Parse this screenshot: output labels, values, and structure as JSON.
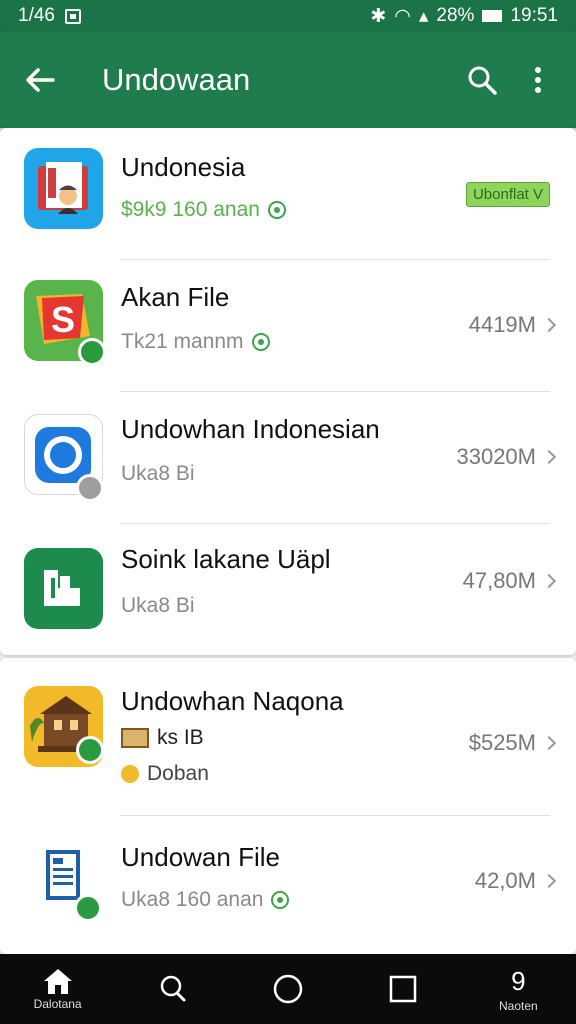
{
  "status_bar": {
    "left_text": "1/46",
    "battery": "28%",
    "time": "19:51"
  },
  "app_bar": {
    "title": "Undowaan"
  },
  "rows": [
    {
      "name": "Undonesia",
      "sub": "$9k9 160 anan",
      "tag": "Ubonflat V"
    },
    {
      "name": "Akan File",
      "sub": "Tk21 mannm",
      "size": "4419M"
    },
    {
      "name": "Undowhan Indonesian",
      "sub": "Uka8 Bi",
      "size": "33020M"
    },
    {
      "name": "Soink lakane Uäpl",
      "sub": "Uka8 Bi",
      "size": "47,80M"
    },
    {
      "name": "Undowhan Naqona",
      "sub": "ks IB",
      "sub2": "Doban",
      "size": "$525M"
    },
    {
      "name": "Undowan File",
      "sub": "Uka8 160 anan",
      "size": "42,0M"
    }
  ],
  "bottom_nav": [
    {
      "label": "Dalotana",
      "icon": "home-icon"
    },
    {
      "label": "",
      "icon": "search-icon"
    },
    {
      "label": "",
      "icon": "circle-home-icon"
    },
    {
      "label": "",
      "icon": "square-recents-icon"
    },
    {
      "label": "Naoten",
      "icon": "number-9-icon"
    }
  ],
  "colors": {
    "primary": "#1f7c4c",
    "status": "#1b7447",
    "accent_green": "#58b24b"
  }
}
